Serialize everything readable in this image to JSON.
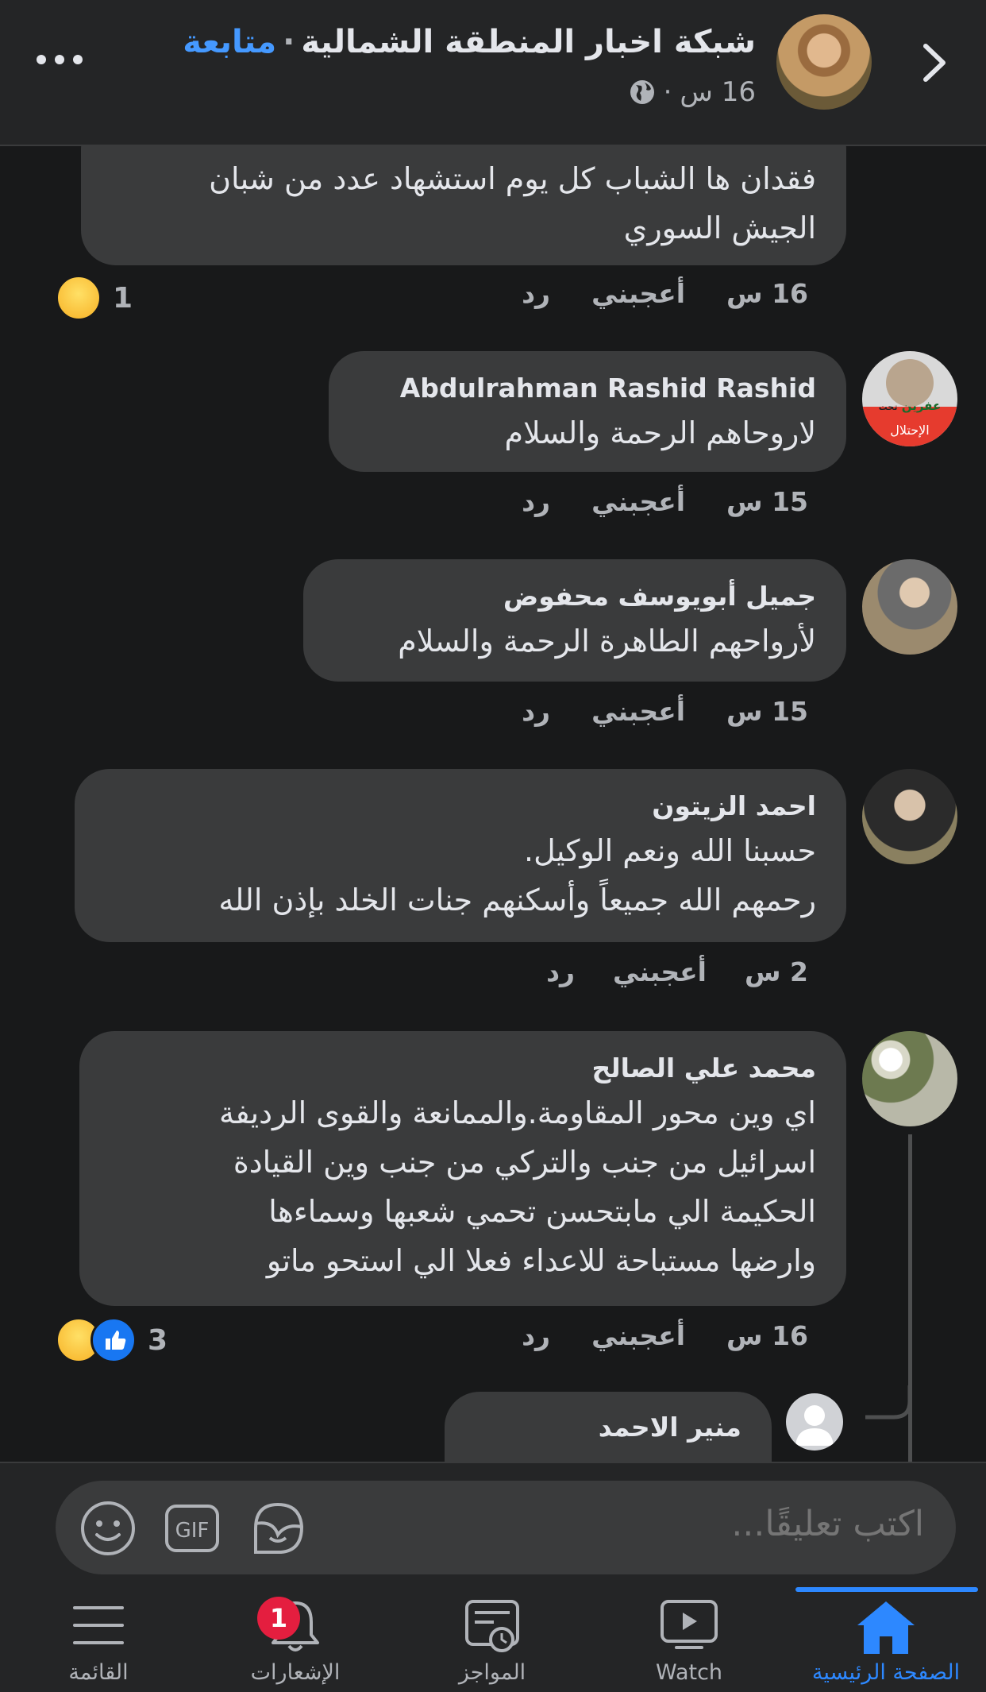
{
  "header": {
    "page_name": "شبكة اخبار المنطقة الشمالية",
    "separator": "·",
    "follow_label": "متابعة",
    "time": "16 س",
    "time_separator": "·"
  },
  "comments": [
    {
      "author": "",
      "text": "فقدان ها الشباب كل يوم استشهاد عدد من شبان\nالجيش السوري",
      "time": "16 س",
      "like_label": "أعجبني",
      "reply_label": "رد",
      "reaction_count": "1"
    },
    {
      "author": "Abdulrahman Rashid Rashid",
      "text": "لاروحاهم الرحمة والسلام",
      "time": "15 س",
      "like_label": "أعجبني",
      "reply_label": "رد",
      "avatar_text_1": "عفرين",
      "avatar_text_2": "تحت",
      "avatar_text_3": "الإحتلال"
    },
    {
      "author": "جميل أبويوسف محفوض",
      "text": "لأرواحهم الطاهرة الرحمة والسلام",
      "time": "15 س",
      "like_label": "أعجبني",
      "reply_label": "رد"
    },
    {
      "author": "احمد الزيتون",
      "text": "حسبنا الله ونعم الوكيل.\nرحمهم الله جميعاً وأسكنهم جنات الخلد بإذن الله",
      "time": "2 س",
      "like_label": "أعجبني",
      "reply_label": "رد"
    },
    {
      "author": "محمد علي الصالح",
      "text": "اي وين محور المقاومة.والممانعة والقوى الرديفة\nاسرائيل من جنب والتركي من جنب وين القيادة\nالحكيمة الي مابتحسن تحمي شعبها وسماءها\nوارضها مستباحة للاعداء فعلا الي استحو ماتو",
      "time": "16 س",
      "like_label": "أعجبني",
      "reply_label": "رد",
      "reaction_count": "3"
    },
    {
      "author": "منير الاحمد"
    }
  ],
  "composer": {
    "placeholder": "اكتب تعليقًا..."
  },
  "tabs": [
    {
      "label": "الصفحة الرئيسية",
      "icon": "home-icon",
      "active": true
    },
    {
      "label": "Watch",
      "icon": "watch-icon"
    },
    {
      "label": "المواجز",
      "icon": "feeds-icon"
    },
    {
      "label": "الإشعارات",
      "icon": "bell-icon",
      "badge": "1"
    },
    {
      "label": "القائمة",
      "icon": "menu-icon"
    }
  ],
  "colors": {
    "background": "#18191a",
    "surface": "#242526",
    "bubble": "#3a3b3c",
    "accent": "#2d88ff",
    "follow": "#4599ff",
    "badge": "#e41e3f"
  }
}
